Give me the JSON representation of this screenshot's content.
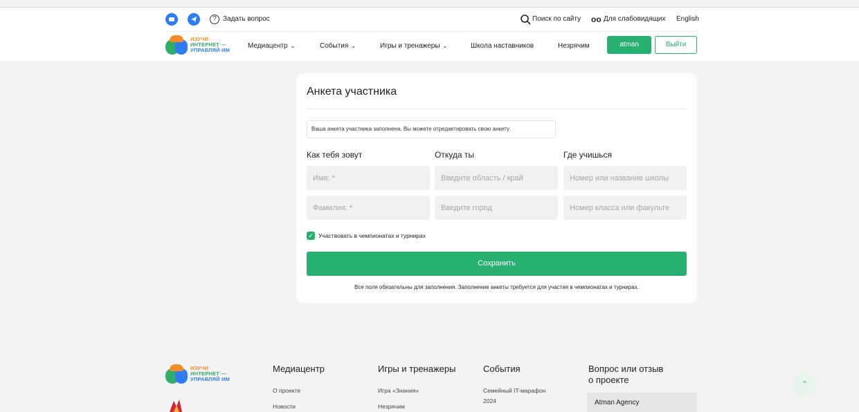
{
  "colors": {
    "accent": "#27b06f",
    "brand_blue": "#2f7cf6",
    "brand_orange": "#f28c28"
  },
  "header": {
    "ask_question": "Задать вопрос",
    "search": "Поиск по сайту",
    "accessibility": "Для слабовидящих",
    "language": "English",
    "logo": {
      "line1": "ИЗУЧИ",
      "line2": "ИНТЕРНЕТ —",
      "line3": "УПРАВЛЯЙ ИМ"
    },
    "nav": [
      {
        "label": "Медиацентр",
        "icon": "chevron-down-icon"
      },
      {
        "label": "События",
        "icon": "chevron-down-icon"
      },
      {
        "label": "Игры и тренажеры",
        "icon": "chevron-down-icon"
      },
      {
        "label": "Школа наставников"
      },
      {
        "label": "Незрячим"
      }
    ],
    "user_button": "atman",
    "logout_button": "Выйти"
  },
  "form": {
    "title": "Анкета участника",
    "notice": "Ваша анкета участника заполнена. Вы можете отредактировать свою анкету.",
    "sections": [
      "Как тебя зовут",
      "Откуда ты",
      "Где учишься"
    ],
    "fields": {
      "first_name": {
        "placeholder": "Имя: *",
        "value": ""
      },
      "last_name": {
        "placeholder": "Фамилия: *",
        "value": ""
      },
      "region": {
        "placeholder": "Введите область / край",
        "value": ""
      },
      "city": {
        "placeholder": "Введите город",
        "value": ""
      },
      "school": {
        "placeholder": "Номер или название школы",
        "value": ""
      },
      "class": {
        "placeholder": "Номер класса или факульте",
        "value": ""
      }
    },
    "checkbox": {
      "label": "Участвовать в чемпионатах и турнирах",
      "checked": true
    },
    "save_button": "Сохранить",
    "note": "Все поля обязательны для заполнения. Заполнение анкеты требуется для участия в чемпионатах и турнирах."
  },
  "footer": {
    "logo": {
      "line1": "ИЗУЧИ",
      "line2": "ИНТЕРНЕТ —",
      "line3": "УПРАВЛЯЙ ИМ"
    },
    "mediacenter": {
      "title": "Медиацентр",
      "links": [
        "О проекте",
        "Новости"
      ]
    },
    "games": {
      "title": "Игры и тренажеры",
      "links": [
        "Игра «Знания»",
        "Незрячим"
      ]
    },
    "events": {
      "title": "События",
      "links": [
        "Семейный IT-марафон",
        "2024"
      ]
    },
    "feedback": {
      "title_line1": "Вопрос или отзыв",
      "title_line2": "о проекте",
      "box_text": "Atman Agency"
    },
    "scroll_top_icon": "chevron-up-icon"
  }
}
